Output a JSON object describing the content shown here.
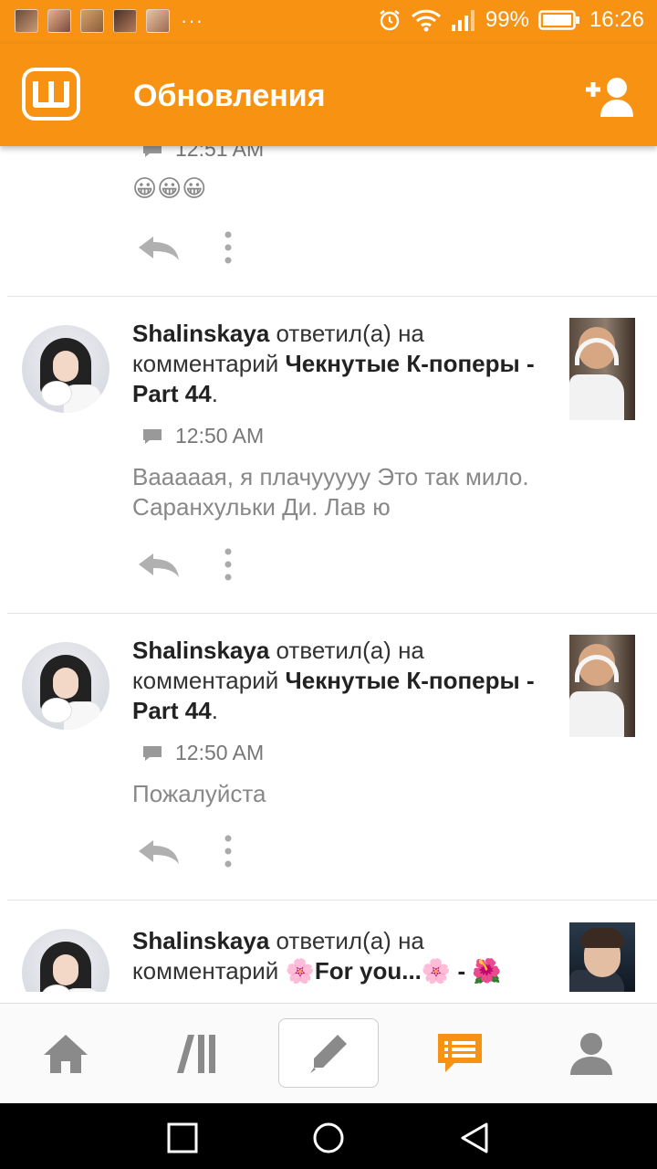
{
  "status_bar": {
    "battery": "99%",
    "time": "16:26",
    "more": "···"
  },
  "app_bar": {
    "logo_letter": "ш",
    "title": "Обновления"
  },
  "feed": {
    "partial_item": {
      "time": "12:51 AM",
      "message": "😀😀😀"
    },
    "items": [
      {
        "user": "Shalinskaya",
        "action": "ответил(а) на комментарий",
        "story": "Чекнутые К-поперы - Part 44",
        "end": ".",
        "time": "12:50 AM",
        "message": "Вааааая, я плачууууу Это так мило.  Саранхульки Ди. Лав ю"
      },
      {
        "user": "Shalinskaya",
        "action": "ответил(а) на комментарий",
        "story": "Чекнутые К-поперы - Part 44",
        "end": ".",
        "time": "12:50 AM",
        "message": "Пожалуйста"
      },
      {
        "user": "Shalinskaya",
        "action": "ответил(а) на комментарий",
        "story": "🌸For you...🌸 - 🌺",
        "end": ""
      }
    ]
  },
  "bottom_nav": {
    "items": [
      "home-icon",
      "library-icon",
      "write-icon",
      "notifications-icon",
      "profile-icon"
    ],
    "active": "notifications-icon"
  },
  "colors": {
    "brand_orange": "#f79213",
    "text_gray": "#888888"
  }
}
